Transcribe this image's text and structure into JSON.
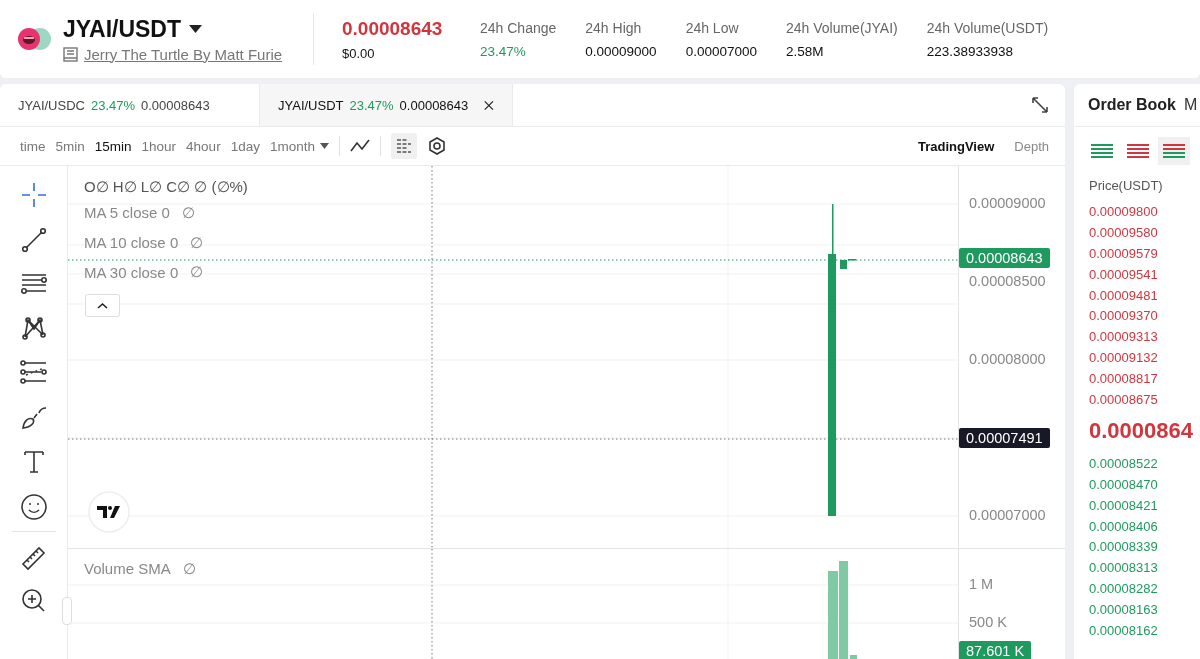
{
  "header": {
    "pair": "JYAI/USDT",
    "name": "Jerry The Turtle By Matt Furie",
    "price": "0.00008643",
    "price_usd": "$0.00",
    "stats": [
      {
        "label": "24h Change",
        "value": "23.47%",
        "kind": "change"
      },
      {
        "label": "24h High",
        "value": "0.00009000",
        "kind": "plain"
      },
      {
        "label": "24h Low",
        "value": "0.00007000",
        "kind": "plain"
      },
      {
        "label": "24h Volume(JYAI)",
        "value": "2.58M",
        "kind": "plain"
      },
      {
        "label": "24h Volume(USDT)",
        "value": "223.38933938",
        "kind": "plain"
      }
    ]
  },
  "pair_tabs": [
    {
      "pair": "JYAI/USDC",
      "change": "23.47%",
      "price": "0.00008643",
      "selected": false
    },
    {
      "pair": "JYAI/USDT",
      "change": "23.47%",
      "price": "0.00008643",
      "selected": true
    }
  ],
  "toolbar": {
    "intervals": [
      {
        "label": "time",
        "selected": false,
        "kind": "plain"
      },
      {
        "label": "5min",
        "selected": false,
        "kind": "plain"
      },
      {
        "label": "15min",
        "selected": true,
        "kind": "plain"
      },
      {
        "label": "1hour",
        "selected": false,
        "kind": "plain"
      },
      {
        "label": "4hour",
        "selected": false,
        "kind": "plain"
      },
      {
        "label": "1day",
        "selected": false,
        "kind": "plain"
      },
      {
        "label": "1month",
        "selected": false,
        "kind": "dropdown"
      }
    ],
    "views": [
      {
        "label": "TradingView",
        "selected": true
      },
      {
        "label": "Depth",
        "selected": false
      }
    ]
  },
  "tools": [
    {
      "kind": "crosshair",
      "selected": true
    },
    {
      "kind": "trend-line",
      "selected": false
    },
    {
      "kind": "horizontal-lines",
      "selected": false
    },
    {
      "kind": "pattern",
      "selected": false
    },
    {
      "kind": "fib",
      "selected": false
    },
    {
      "kind": "brush",
      "selected": false
    },
    {
      "kind": "text",
      "selected": false
    },
    {
      "kind": "emoji",
      "selected": false
    },
    {
      "kind": "ruler",
      "selected": false
    },
    {
      "kind": "zoom",
      "selected": false
    }
  ],
  "chart": {
    "legend": "O∅ H∅ L∅ C∅ ∅ (∅%)",
    "indicators": [
      {
        "label": "MA 5 close 0",
        "value": "∅"
      },
      {
        "label": "MA 10 close 0",
        "value": "∅"
      },
      {
        "label": "MA 30 close 0",
        "value": "∅"
      }
    ],
    "price_axis": [
      "0.00009000",
      "0.00008500",
      "0.00008000",
      "0.00007000"
    ],
    "last_price": "0.00008643",
    "crosshair_price": "0.00007491",
    "volume_legend": {
      "label": "Volume SMA",
      "value": "∅"
    },
    "volume_axis": [
      "1 M",
      "500 K"
    ],
    "last_volume": "87.601 K"
  },
  "order_book": {
    "title": "Order Book",
    "next_tab": "M",
    "column": "Price(USDT)",
    "views": [
      {
        "kind": "bids",
        "selected": false
      },
      {
        "kind": "asks",
        "selected": false
      },
      {
        "kind": "both",
        "selected": true
      }
    ],
    "asks": [
      {
        "price": "0.00009800"
      },
      {
        "price": "0.00009580"
      },
      {
        "price": "0.00009579"
      },
      {
        "price": "0.00009541"
      },
      {
        "price": "0.00009481"
      },
      {
        "price": "0.00009370"
      },
      {
        "price": "0.00009313"
      },
      {
        "price": "0.00009132"
      },
      {
        "price": "0.00008817"
      },
      {
        "price": "0.00008675"
      }
    ],
    "mid_price": "0.0000864",
    "bids": [
      {
        "price": "0.00008522"
      },
      {
        "price": "0.00008470"
      },
      {
        "price": "0.00008421"
      },
      {
        "price": "0.00008406"
      },
      {
        "price": "0.00008339"
      },
      {
        "price": "0.00008313"
      },
      {
        "price": "0.00008282"
      },
      {
        "price": "0.00008163"
      },
      {
        "price": "0.00008162"
      }
    ]
  }
}
